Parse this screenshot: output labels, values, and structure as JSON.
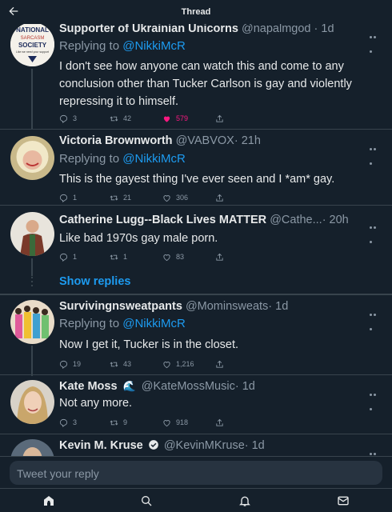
{
  "header": {
    "title": "Thread",
    "back_icon": "arrow-left-icon"
  },
  "tweets": [
    {
      "name": "Supporter of Ukrainian Unicorns",
      "handle": "@napalmgod",
      "time": "· 1d",
      "replying_label": "Replying to ",
      "replying_to": "@NikkiMcR",
      "text": "I don't see how anyone can watch this and come to any conclusion other than Tucker Carlson is gay and violently repressing it to himself.",
      "avatar_text": {
        "line1": "NATIONAL",
        "line2": "SARCASM",
        "line3": "SOCIETY",
        "line4": "Like we need your support"
      },
      "replies": "3",
      "retweets": "42",
      "likes": "579",
      "liked": true
    },
    {
      "name": "Victoria Brownworth",
      "handle": "@VABVOX",
      "time": "· 21h",
      "replying_label": "Replying to ",
      "replying_to": "@NikkiMcR",
      "text": "This is the gayest thing I've ever seen and I *am* gay.",
      "replies": "1",
      "retweets": "21",
      "likes": "306",
      "liked": false
    },
    {
      "name": "Catherine Lugg--Black Lives MATTER",
      "handle": "@Cathe...",
      "time": "· 20h",
      "text": "Like bad 1970s gay male porn.",
      "replies": "1",
      "retweets": "1",
      "likes": "83",
      "liked": false
    },
    {
      "name": "Survivingnsweatpants",
      "handle": "@Mominsweats",
      "time": "· 1d",
      "replying_label": "Replying to ",
      "replying_to": "@NikkiMcR",
      "text": "Now I get it, Tucker is in the closet.",
      "replies": "19",
      "retweets": "43",
      "likes": "1,216",
      "liked": false
    },
    {
      "name": "Kate Moss",
      "emoji": "🌊",
      "handle": "@KateMossMusic",
      "time": "· 1d",
      "text": "Not any more.",
      "replies": "3",
      "retweets": "9",
      "likes": "918",
      "liked": false
    },
    {
      "name": "Kevin M. Kruse",
      "verified": true,
      "handle": "@KevinMKruse",
      "time": "· 1d"
    }
  ],
  "show_replies": "Show replies",
  "compose": {
    "placeholder": "Tweet your reply"
  },
  "navbar": {
    "icons": [
      "home-icon",
      "search-icon",
      "notifications-icon",
      "messages-icon"
    ]
  },
  "colors": {
    "background": "#15202b",
    "accent": "#1d9bf0",
    "like": "#f91880",
    "muted": "#8b98a5",
    "border": "#38444d"
  }
}
